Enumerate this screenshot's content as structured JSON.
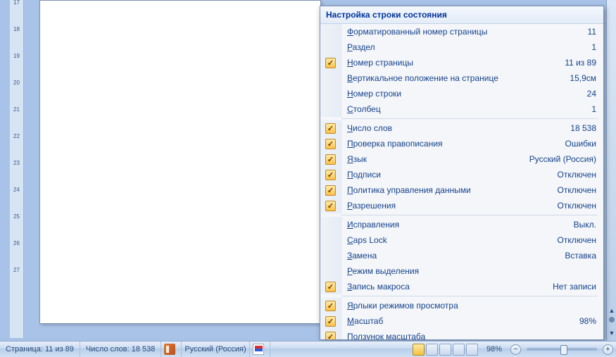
{
  "ruler": {
    "start": 17,
    "end": 27
  },
  "status": {
    "page_label": "Страница: 11 из 89",
    "words_label": "Число слов: 18 538",
    "language": "Русский (Россия)",
    "zoom": "98%"
  },
  "menu": {
    "title": "Настройка строки состояния",
    "items": [
      {
        "checked": false,
        "label": "Форматированный номер страницы",
        "value": "11"
      },
      {
        "checked": false,
        "label": "Раздел",
        "value": "1"
      },
      {
        "checked": true,
        "label": "Номер страницы",
        "value": "11 из 89"
      },
      {
        "checked": false,
        "label": "Вертикальное положение на странице",
        "value": "15,9см"
      },
      {
        "checked": false,
        "label": "Номер строки",
        "value": "24"
      },
      {
        "checked": false,
        "label": "Столбец",
        "value": "1"
      },
      {
        "sep": true
      },
      {
        "checked": true,
        "label": "Число слов",
        "value": "18 538"
      },
      {
        "checked": true,
        "label": "Проверка правописания",
        "value": "Ошибки"
      },
      {
        "checked": true,
        "label": "Язык",
        "value": "Русский (Россия)"
      },
      {
        "checked": true,
        "label": "Подписи",
        "value": "Отключен"
      },
      {
        "checked": true,
        "label": "Политика управления данными",
        "value": "Отключен"
      },
      {
        "checked": true,
        "label": "Разрешения",
        "value": "Отключен"
      },
      {
        "sep": true
      },
      {
        "checked": false,
        "label": "Исправления",
        "value": "Выкл."
      },
      {
        "checked": false,
        "label": "Caps Lock",
        "value": "Отключен"
      },
      {
        "checked": false,
        "label": "Замена",
        "value": "Вставка"
      },
      {
        "checked": false,
        "label": "Режим выделения",
        "value": ""
      },
      {
        "checked": true,
        "label": "Запись макроса",
        "value": "Нет записи"
      },
      {
        "sep": true
      },
      {
        "checked": true,
        "label": "Ярлыки режимов просмотра",
        "value": ""
      },
      {
        "checked": true,
        "label": "Масштаб",
        "value": "98%"
      },
      {
        "checked": true,
        "label": "Ползунок масштаба",
        "value": ""
      }
    ]
  }
}
